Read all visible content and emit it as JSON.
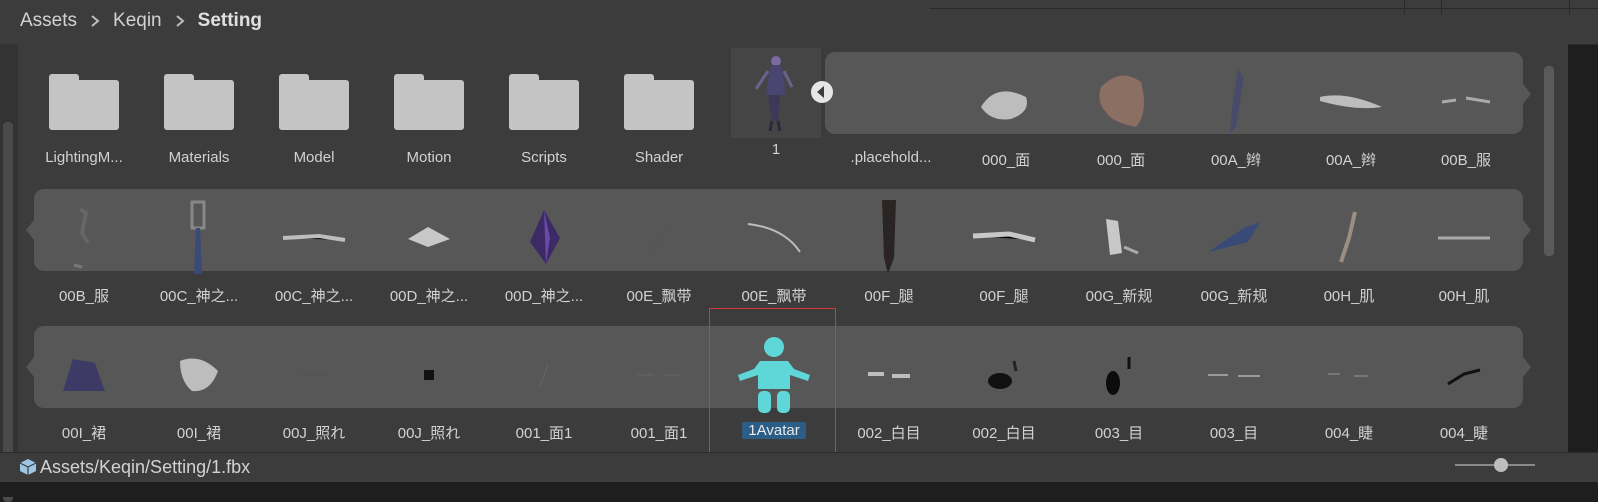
{
  "breadcrumb": {
    "segments": [
      "Assets",
      "Keqin",
      "Setting"
    ]
  },
  "folders": [
    {
      "label": "LightingM..."
    },
    {
      "label": "Materials"
    },
    {
      "label": "Model"
    },
    {
      "label": "Motion"
    },
    {
      "label": "Scripts"
    },
    {
      "label": "Shader"
    }
  ],
  "model_asset": {
    "label": "1"
  },
  "row1_sub_items": [
    {
      "label": ".placehold..."
    },
    {
      "label": "000_面"
    },
    {
      "label": "000_面"
    },
    {
      "label": "00A_辫"
    },
    {
      "label": "00A_辫"
    },
    {
      "label": "00B_服"
    }
  ],
  "row2_items": [
    {
      "label": "00B_服"
    },
    {
      "label": "00C_神之..."
    },
    {
      "label": "00C_神之..."
    },
    {
      "label": "00D_神之..."
    },
    {
      "label": "00D_神之..."
    },
    {
      "label": "00E_飘带"
    },
    {
      "label": "00E_飘带"
    },
    {
      "label": "00F_腿"
    },
    {
      "label": "00F_腿"
    },
    {
      "label": "00G_新规"
    },
    {
      "label": "00G_新规"
    },
    {
      "label": "00H_肌"
    },
    {
      "label": "00H_肌"
    }
  ],
  "row3_items": [
    {
      "label": "00I_裙"
    },
    {
      "label": "00I_裙"
    },
    {
      "label": "00J_照れ"
    },
    {
      "label": "00J_照れ"
    },
    {
      "label": "001_面1"
    },
    {
      "label": "001_面1"
    },
    {
      "label": "1Avatar"
    },
    {
      "label": "002_白目"
    },
    {
      "label": "002_白目"
    },
    {
      "label": "003_目"
    },
    {
      "label": "003_目"
    },
    {
      "label": "004_睫"
    },
    {
      "label": "004_睫"
    }
  ],
  "status": {
    "path": "Assets/Keqin/Setting/1.fbx"
  },
  "icons": {
    "breadcrumb_sep": "chevron-right-icon",
    "folder": "folder-icon",
    "collapse": "collapse-left-icon",
    "avatar": "avatar-humanoid-icon",
    "status_model": "model-cube-icon"
  },
  "colors": {
    "avatar": "#5fd6d8",
    "selection_border": "#d33a3a",
    "selected_label_bg": "#2c5d87"
  }
}
